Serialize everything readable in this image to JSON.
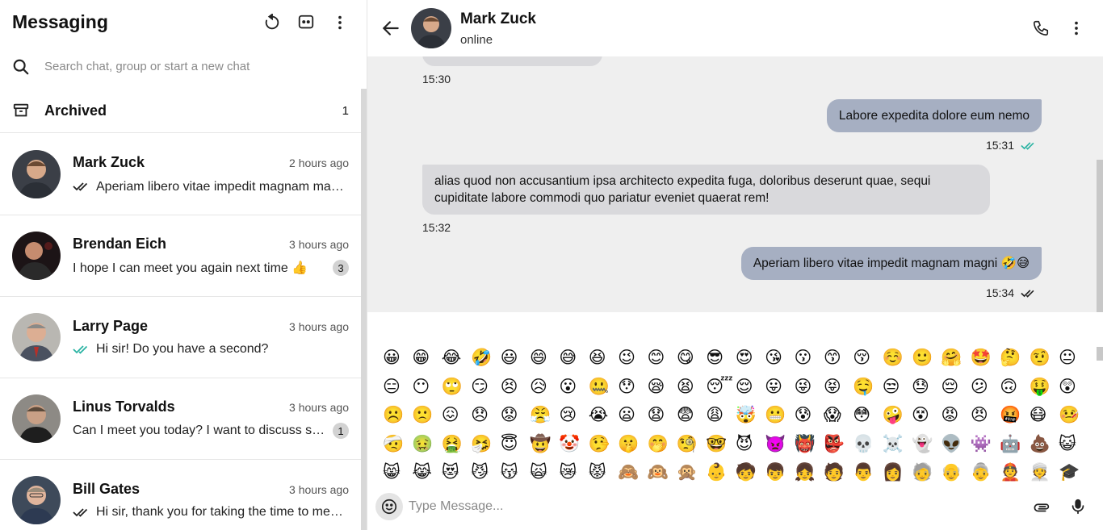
{
  "sidebar": {
    "title": "Messaging",
    "search_placeholder": "Search chat, group or start a new chat",
    "archived_label": "Archived",
    "archived_count": "1",
    "chats": [
      {
        "name": "Mark Zuck",
        "time": "2 hours ago",
        "preview": "Aperiam libero vitae impedit magnam magni 🤣😅",
        "status": "read",
        "unread": ""
      },
      {
        "name": "Brendan Eich",
        "time": "3 hours ago",
        "preview": "I hope I can meet you again next time 👍",
        "status": "none",
        "unread": "3"
      },
      {
        "name": "Larry Page",
        "time": "3 hours ago",
        "preview": "Hi sir! Do you have a second?",
        "status": "seen",
        "unread": ""
      },
      {
        "name": "Linus Torvalds",
        "time": "3 hours ago",
        "preview": "Can I meet you today? I want to discuss something with you",
        "status": "none",
        "unread": "1"
      },
      {
        "name": "Bill Gates",
        "time": "3 hours ago",
        "preview": "Hi sir, thank you for taking the time to meet me",
        "status": "read",
        "unread": ""
      }
    ]
  },
  "chat": {
    "name": "Mark Zuck",
    "status": "online",
    "messages": [
      {
        "direction": "in",
        "text": "",
        "time": "15:30"
      },
      {
        "direction": "out",
        "text": "Labore expedita dolore eum nemo",
        "time": "15:31",
        "ticks": "seen"
      },
      {
        "direction": "in",
        "text": "alias quod non accusantium ipsa architecto expedita fuga, doloribus deserunt quae, sequi cupiditate labore commodi quo pariatur eveniet quaerat rem!",
        "time": "15:32"
      },
      {
        "direction": "out",
        "text": "Aperiam libero vitae impedit magnam magni 🤣😅",
        "time": "15:34",
        "ticks": "read"
      }
    ],
    "composer_placeholder": "Type Message..."
  },
  "emojis": [
    "😀",
    "😁",
    "😂",
    "🤣",
    "😃",
    "😄",
    "😅",
    "😆",
    "😉",
    "😊",
    "😋",
    "😎",
    "😍",
    "😘",
    "😗",
    "😙",
    "😚",
    "☺️",
    "🙂",
    "🤗",
    "🤩",
    "🤔",
    "🤨",
    "😐",
    "😑",
    "😶",
    "🙄",
    "😏",
    "😣",
    "😥",
    "😮",
    "🤐",
    "😯",
    "😪",
    "😫",
    "😴",
    "😌",
    "😛",
    "😜",
    "😝",
    "🤤",
    "😒",
    "😓",
    "😔",
    "😕",
    "🙃",
    "🤑",
    "😲",
    "☹️",
    "🙁",
    "😖",
    "😞",
    "😟",
    "😤",
    "😢",
    "😭",
    "😦",
    "😧",
    "😨",
    "😩",
    "🤯",
    "😬",
    "😰",
    "😱",
    "😳",
    "🤪",
    "😵",
    "😡",
    "😠",
    "🤬",
    "😷",
    "🤒",
    "🤕",
    "🤢",
    "🤮",
    "🤧",
    "😇",
    "🤠",
    "🤡",
    "🤥",
    "🤫",
    "🤭",
    "🧐",
    "🤓",
    "😈",
    "👿",
    "👹",
    "👺",
    "💀",
    "☠️",
    "👻",
    "👽",
    "👾",
    "🤖",
    "💩",
    "😺",
    "😸",
    "😹",
    "😻",
    "😼",
    "😽",
    "🙀",
    "😿",
    "😾",
    "🙈",
    "🙉",
    "🙊",
    "👶",
    "🧒",
    "👦",
    "👧",
    "🧑",
    "👨",
    "👩",
    "🧓",
    "👴",
    "👵",
    "👲",
    "👳",
    "🎓"
  ],
  "colors": {
    "outgoing_bubble": "#a6afc2",
    "incoming_bubble": "#d9d9dc",
    "seen_tick": "#2bb3a3",
    "message_bg": "#efefef"
  }
}
